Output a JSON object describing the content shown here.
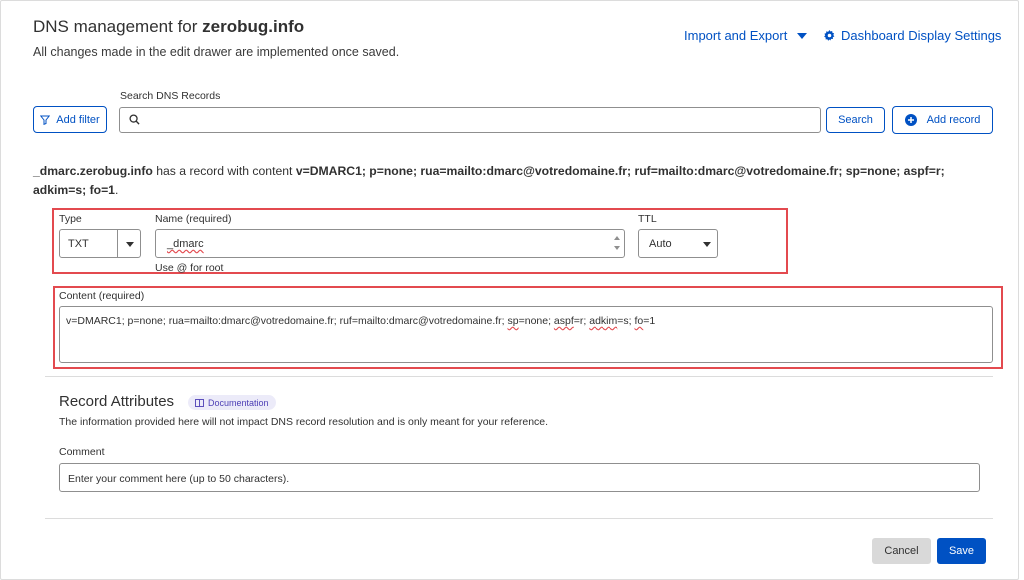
{
  "header": {
    "title_prefix": "DNS management for ",
    "title_domain": "zerobug.info",
    "subtitle": "All changes made in the edit drawer are implemented once saved.",
    "import_export": "Import and Export",
    "display_settings": "Dashboard Display Settings"
  },
  "toolbar": {
    "add_filter": "Add filter",
    "search_label": "Search DNS Records",
    "search_value": "",
    "search_button": "Search",
    "add_record": "Add record"
  },
  "record_summary": {
    "name": "_dmarc.zerobug.info",
    "middle": " has a record with content ",
    "content": "v=DMARC1; p=none; rua=mailto:dmarc@votredomaine.fr; ruf=mailto:dmarc@votredomaine.fr; sp=none; aspf=r; adkim=s; fo=1",
    "end": "."
  },
  "form": {
    "type_label": "Type",
    "type_value": "TXT",
    "name_label": "Name (required)",
    "name_value": "_dmarc",
    "name_hint": "Use @ for root",
    "ttl_label": "TTL",
    "ttl_value": "Auto",
    "content_label": "Content (required)",
    "content_parts": [
      "v=DMARC1; p=none; rua=mailto:dmarc@votredomaine.fr; ruf=mailto:dmarc@votredomaine.fr; ",
      "sp",
      "=none; ",
      "aspf",
      "=r; ",
      "adkim",
      "=s; ",
      "fo",
      "=1"
    ]
  },
  "attributes": {
    "title": "Record Attributes",
    "doc_badge": "Documentation",
    "description": "The information provided here will not impact DNS record resolution and is only meant for your reference.",
    "comment_label": "Comment",
    "comment_placeholder": "Enter your comment here (up to 50 characters).",
    "comment_value": ""
  },
  "footer": {
    "cancel": "Cancel",
    "save": "Save"
  },
  "colors": {
    "accent": "#0051c3",
    "highlight_border": "#e34a4f",
    "cancel_bg": "#d9d9d9",
    "badge_bg": "#ecebf9"
  },
  "icons": {
    "filter": "funnel-icon",
    "search": "magnifier-icon",
    "add": "plus-circle-icon",
    "settings": "gear-icon",
    "docs": "book-icon"
  }
}
